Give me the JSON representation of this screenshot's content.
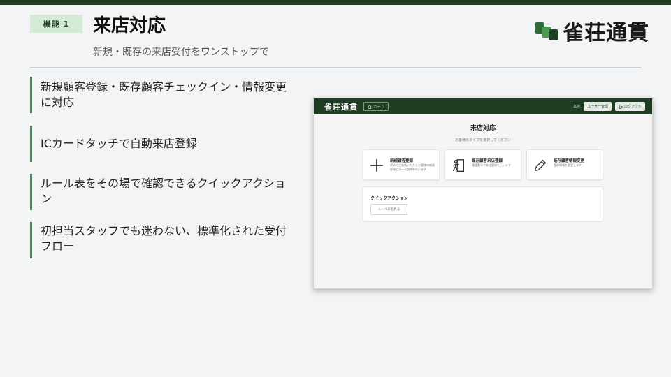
{
  "slide": {
    "badge": "機能 1",
    "title": "来店対応",
    "subtitle": "新規・既存の来店受付をワンストップで",
    "logo_text": "雀荘通貫",
    "features": [
      "新規顧客登録・既存顧客チェックイン・情報変更に対応",
      "ICカードタッチで自動来店登録",
      "ルール表をその場で確認できるクイックアクション",
      "初担当スタッフでも迷わない、標準化された受付フロー"
    ]
  },
  "app": {
    "logo_text": "雀荘通貫",
    "home_label": "ホーム",
    "header_text": "本店",
    "user_mgmt_label": "ユーザー管理",
    "logout_label": "ログアウト",
    "page_title": "来店対応",
    "page_subtitle": "お客様のタイプを選択してください",
    "cards": [
      {
        "title": "新規顧客登録",
        "desc": "初めてご来店いただくお客様の情報登録とルール説明を行います",
        "icon": "plus-icon"
      },
      {
        "title": "既存顧客来店登録",
        "desc": "電話番号で来店登録を行います",
        "icon": "door-enter-icon"
      },
      {
        "title": "既存顧客情報変更",
        "desc": "登録情報を変更します",
        "icon": "pencil-icon"
      }
    ],
    "quick_action_title": "クイックアクション",
    "rules_button_label": "ルール表を見る"
  },
  "colors": {
    "brand_dark_green": "#1e3d22",
    "accent_green": "#3f8a4a",
    "badge_bg": "#d4ecd6"
  }
}
